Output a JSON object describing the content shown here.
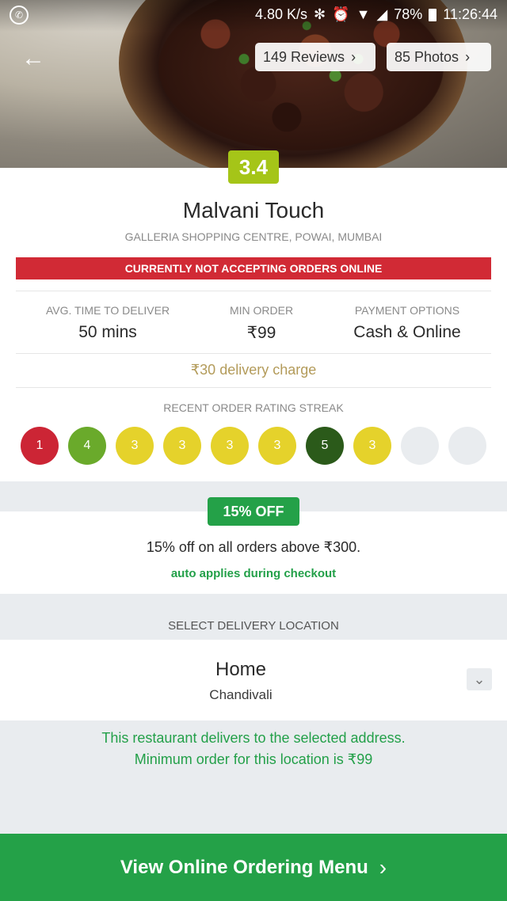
{
  "statusbar": {
    "app_icon": "whatsapp-icon",
    "net_speed": "4.80 K/s",
    "bluetooth": "✻",
    "alarm": "⏰",
    "wifi": "▼",
    "signal": "◢",
    "battery": "78%",
    "time": "11:26:44"
  },
  "hero": {
    "back_icon": "←",
    "reviews_label": "149 Reviews",
    "photos_label": "85 Photos",
    "chevron": "›"
  },
  "restaurant": {
    "rating": "3.4",
    "name": "Malvani Touch",
    "address": "GALLERIA SHOPPING CENTRE, POWAI, MUMBAI",
    "banner": "CURRENTLY NOT ACCEPTING ORDERS ONLINE"
  },
  "info": [
    {
      "label": "AVG. TIME TO DELIVER",
      "value": "50 mins"
    },
    {
      "label": "MIN ORDER",
      "value": "₹99"
    },
    {
      "label": "PAYMENT OPTIONS",
      "value": "Cash & Online"
    }
  ],
  "delivery_charge": "₹30 delivery charge",
  "streak": {
    "title": "RECENT ORDER RATING STREAK",
    "items": [
      {
        "value": "1",
        "color": "#cc2535"
      },
      {
        "value": "4",
        "color": "#6aaa2b"
      },
      {
        "value": "3",
        "color": "#e5d22b"
      },
      {
        "value": "3",
        "color": "#e5d22b"
      },
      {
        "value": "3",
        "color": "#e5d22b"
      },
      {
        "value": "3",
        "color": "#e5d22b"
      },
      {
        "value": "5",
        "color": "#2b5a1a"
      },
      {
        "value": "3",
        "color": "#e5d22b"
      },
      {
        "value": "",
        "color": "#e9ecef"
      },
      {
        "value": "",
        "color": "#e9ecef"
      }
    ]
  },
  "offer": {
    "badge": "15% OFF",
    "text": "15% off on all orders above ₹300.",
    "sub": "auto applies during checkout"
  },
  "location": {
    "title": "SELECT DELIVERY LOCATION",
    "name": "Home",
    "area": "Chandivali",
    "dropdown_icon": "⌄",
    "message_line1": "This restaurant delivers to the selected address.",
    "message_line2": "Minimum order for this location is ₹99"
  },
  "cta": {
    "label": "View Online Ordering Menu",
    "chevron": "›"
  },
  "colors": {
    "green": "#24a148",
    "red": "#d12a35",
    "rating": "#a5c518"
  }
}
